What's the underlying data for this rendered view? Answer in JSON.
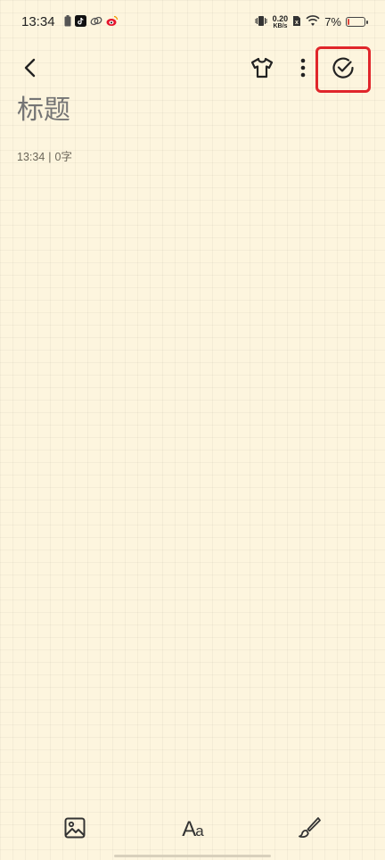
{
  "status_bar": {
    "time": "13:34",
    "net_speed_value": "0.20",
    "net_speed_unit": "KB/s",
    "battery_percent": "7%",
    "battery_level": 0.07,
    "battery_color": "#e0453a",
    "notification_icons": [
      "battery-saver-icon",
      "tiktok-icon",
      "link-app-icon",
      "weibo-icon"
    ],
    "system_icons": [
      "vibrate-icon",
      "net-speed",
      "sim-icon",
      "wifi-icon",
      "battery-icon"
    ]
  },
  "toolbar": {
    "back_icon": "chevron-left-icon",
    "theme_icon": "tshirt-icon",
    "more_icon": "more-vertical-icon",
    "done_icon": "check-circle-icon",
    "done_highlight_color": "#e0262b"
  },
  "note": {
    "title_placeholder": "标题",
    "time": "13:34",
    "separator": "|",
    "word_count": "0字"
  },
  "bottom_bar": {
    "image_icon": "image-icon",
    "font_label_big": "A",
    "font_label_small": "a",
    "brush_icon": "brush-icon"
  },
  "colors": {
    "background": "#fdf5de",
    "title_placeholder": "#aea898",
    "highlight": "#e0262b"
  }
}
